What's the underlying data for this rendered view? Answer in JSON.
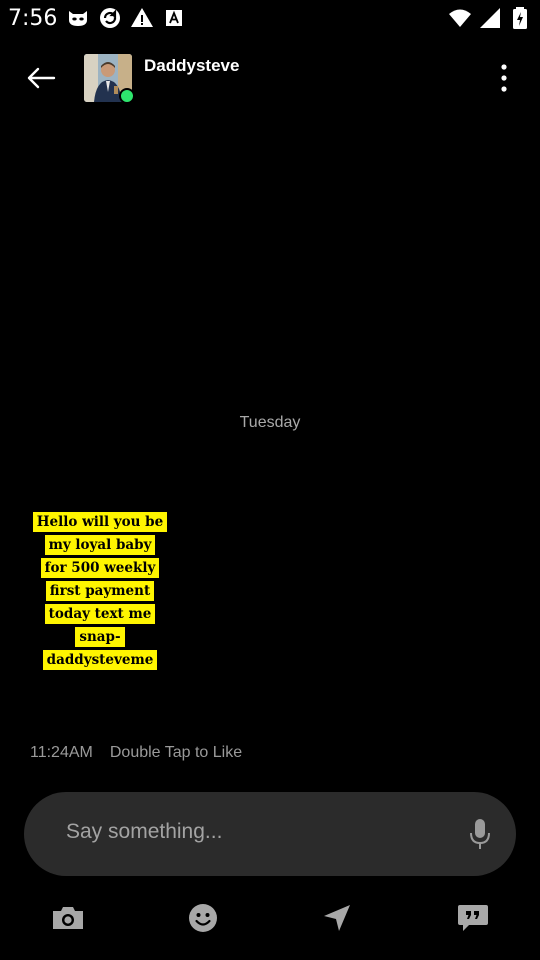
{
  "status_bar": {
    "time": "7:56",
    "icons": [
      "app-mask-icon",
      "sync-icon",
      "warning-icon",
      "text-icon",
      "wifi-icon",
      "signal-icon",
      "battery-icon"
    ]
  },
  "header": {
    "contact_name": "Daddysteve",
    "online": true,
    "online_color": "#2ee66e"
  },
  "chat": {
    "day_label": "Tuesday",
    "message_lines": [
      "Hello will you be",
      "my loyal baby",
      "for 500 weekly",
      "first payment",
      "today text me",
      "snap-",
      "daddysteveme"
    ],
    "highlight_color": "#fff500",
    "time": "11:24AM",
    "like_hint": "Double Tap to Like"
  },
  "composer": {
    "placeholder": "Say something..."
  },
  "toolbar": {
    "buttons": [
      "camera-icon",
      "emoji-icon",
      "send-location-icon",
      "saved-phrases-icon"
    ]
  }
}
